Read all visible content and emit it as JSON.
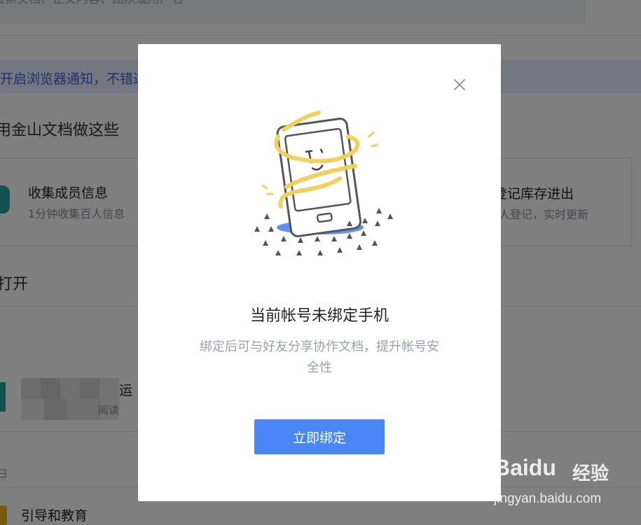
{
  "background": {
    "search": {
      "placeholder": "搜索文档、正文内容、团队或用户名"
    },
    "notification": {
      "text": "开启浏览器通知，不错过"
    },
    "section_use": {
      "heading": "用金山文档做这些"
    },
    "cards": [
      {
        "title": "收集成员信息",
        "subtitle": "1分钟收集百人信息"
      },
      {
        "title": "登记库存进出",
        "subtitle": "人登记，实时更新"
      }
    ],
    "section_open": {
      "heading": "打开"
    },
    "list_items": [
      {
        "title": "运",
        "subtitle": "阅读"
      },
      {
        "title": "引导和教育",
        "subtitle": ""
      }
    ],
    "list_small_label": "日"
  },
  "modal": {
    "title": "当前帐号未绑定手机",
    "description": "绑定后可与好友分享协作文档，提升帐号安全性",
    "bind_button": "立即绑定",
    "close_icon": "close-icon",
    "illustration_icon": "phone-illustration-icon"
  },
  "watermark": {
    "logo": "Baidu",
    "brand": "经验",
    "url": "jingyan.baidu.com"
  },
  "colors": {
    "overlay": "#00000080",
    "button": "#4a86f7",
    "notify_text": "#2f6bd9",
    "illustration_yellow": "#f2d15a",
    "illustration_blue": "#4a86f7"
  }
}
